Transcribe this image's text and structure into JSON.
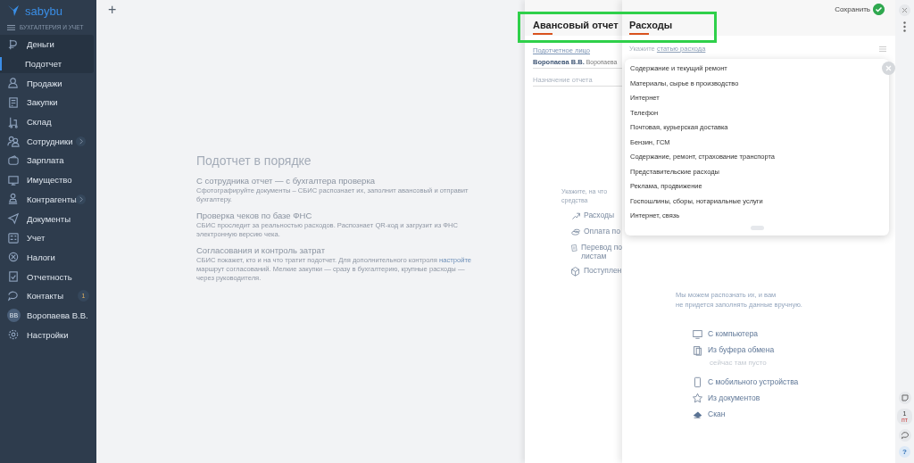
{
  "sidebar": {
    "logo": "sabybu",
    "subtitle": "БУХГАЛТЕРИЯ И УЧЕТ",
    "items": [
      {
        "label": "Деньги",
        "selected": false,
        "has_submenu": false,
        "children": [
          {
            "label": "Подотчет",
            "selected": true
          }
        ]
      },
      {
        "label": "Продажи",
        "selected": false,
        "has_submenu": false
      },
      {
        "label": "Закупки",
        "selected": false,
        "has_submenu": false
      },
      {
        "label": "Склад",
        "selected": false,
        "has_submenu": false
      },
      {
        "label": "Сотрудники",
        "selected": false,
        "has_submenu": true
      },
      {
        "label": "Зарплата",
        "selected": false,
        "has_submenu": false
      },
      {
        "label": "Имущество",
        "selected": false,
        "has_submenu": false
      },
      {
        "label": "Контрагенты",
        "selected": false,
        "has_submenu": true
      },
      {
        "label": "Документы",
        "selected": false,
        "has_submenu": false
      },
      {
        "label": "Учет",
        "selected": false,
        "has_submenu": false
      },
      {
        "label": "Налоги",
        "selected": false,
        "has_submenu": false
      },
      {
        "label": "Отчетность",
        "selected": false,
        "has_submenu": false
      },
      {
        "label": "Контакты",
        "selected": false,
        "has_submenu": false,
        "badge": "1"
      },
      {
        "label": "Воропаева В.В.",
        "selected": false,
        "has_submenu": false,
        "kind": "avatar",
        "initials": "ВВ"
      },
      {
        "label": "Настройки",
        "selected": false,
        "has_submenu": false
      }
    ]
  },
  "main": {
    "add_button": "+",
    "promo": {
      "title": "Подотчет в порядке",
      "sections": [
        {
          "heading": "С сотрудника отчет — с бухгалтера проверка",
          "text": "Сфотографируйте документы – СБИС распознает их, заполнит авансовый и отправит бухгалтеру."
        },
        {
          "heading": "Проверка чеков по базе ФНС",
          "text": "СБИС проследит за реальностью расходов. Распознает QR-код и загрузит из ФНС электронную версию чека."
        },
        {
          "heading": "Согласования и контроль затрат",
          "text": "СБИС покажет, кто и на что тратит подотчет. Для дополнительного контроля",
          "link": "настройте",
          "text_after": "маршрут согласований. Мелкие закупки — сразу в бухгалтерию, крупные расходы — через руководителя."
        }
      ]
    }
  },
  "report_panel": {
    "title": "Авансовый отчет",
    "person_label": "Подотчетное лицо",
    "person": "Воропаева В.В.",
    "person_note": "Воропаева",
    "purpose_placeholder": "Назначение отчета",
    "hint": [
      "Укажите, на что",
      "средства"
    ],
    "actions": [
      [
        "Расходы"
      ],
      [
        "Оплата по"
      ],
      [
        "Перевод по",
        "листам"
      ],
      [
        "Поступлен"
      ]
    ]
  },
  "expenses_panel": {
    "title": "Расходы",
    "save": "Сохранить",
    "field_prefix": "Укажите",
    "field_link": "статью расхода",
    "dropdown": {
      "items": [
        "Содержание и текущий ремонт",
        "Материалы, сырье в производство",
        "Интернет",
        "Телефон",
        "Почтовая, курьерская доставка",
        "Бензин, ГСМ",
        "Содержание, ремонт, страхование транспорта",
        "Представительские расходы",
        "Реклама, продвижение",
        "Госпошлины, сборы, нотариальные услуги",
        "Интернет, связь"
      ]
    },
    "hint": [
      "Мы можем распознать их, и вам",
      "не придется заполнять данные вручную."
    ],
    "sources": [
      {
        "label": "С компьютера"
      },
      {
        "label": "Из буфера обмена",
        "note": "сейчас там пусто"
      },
      {
        "label": "С мобильного устройства"
      },
      {
        "label": "Из документов"
      },
      {
        "label": "Скан"
      }
    ]
  },
  "rail": {
    "calendar_day": "1",
    "calendar_weekday": "пт",
    "help": "?"
  }
}
